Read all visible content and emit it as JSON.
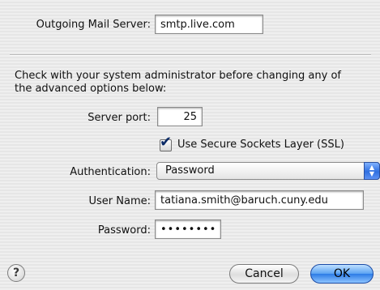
{
  "outgoing": {
    "label": "Outgoing Mail Server:",
    "value": "smtp.live.com"
  },
  "advanced": {
    "note_line1": "Check with your system administrator before changing any of",
    "note_line2": "the advanced options below:",
    "port_label": "Server port:",
    "port_value": "25",
    "ssl_label": "Use Secure Sockets Layer (SSL)",
    "ssl_checked": true,
    "auth_label": "Authentication:",
    "auth_value": "Password",
    "username_label": "User Name:",
    "username_value": "tatiana.smith@baruch.cuny.edu",
    "password_label": "Password:",
    "password_value": "••••••••"
  },
  "buttons": {
    "help": "?",
    "cancel": "Cancel",
    "ok": "OK"
  },
  "icons": {
    "popup_arrows": "updown-arrows-icon",
    "checkmark": "checkmark-icon"
  },
  "colors": {
    "accent": "#2c7be6",
    "window": "#ececec"
  }
}
